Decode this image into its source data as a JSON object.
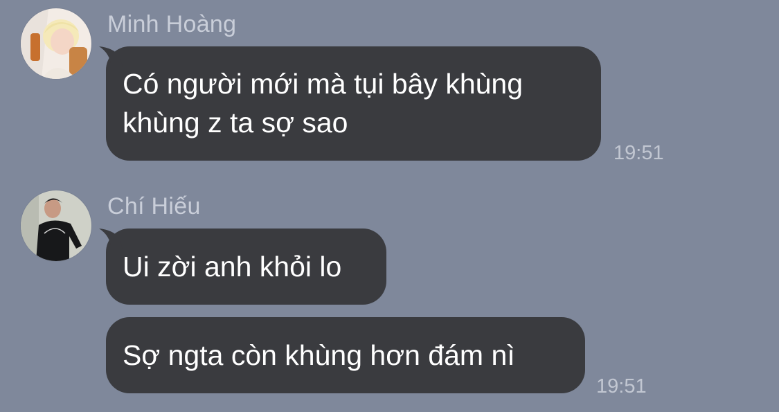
{
  "chat": {
    "colors": {
      "background": "#7f889b",
      "bubble": "#3a3b3f",
      "bubble_text": "#ffffff",
      "meta_text": "#c9ced9"
    },
    "messages": [
      {
        "sender": "Minh Hoàng",
        "avatar": "person-avatar-blonde",
        "bubbles": [
          {
            "text": "Có người mới mà tụi bây khùng\nkhùng z ta sợ sao"
          }
        ],
        "time": "19:51"
      },
      {
        "sender": "Chí Hiếu",
        "avatar": "person-avatar-black-shirt",
        "bubbles": [
          {
            "text": "Ui zời anh khỏi lo"
          },
          {
            "text": "Sợ ngta còn khùng hơn đám nì"
          }
        ],
        "time": "19:51"
      }
    ]
  }
}
